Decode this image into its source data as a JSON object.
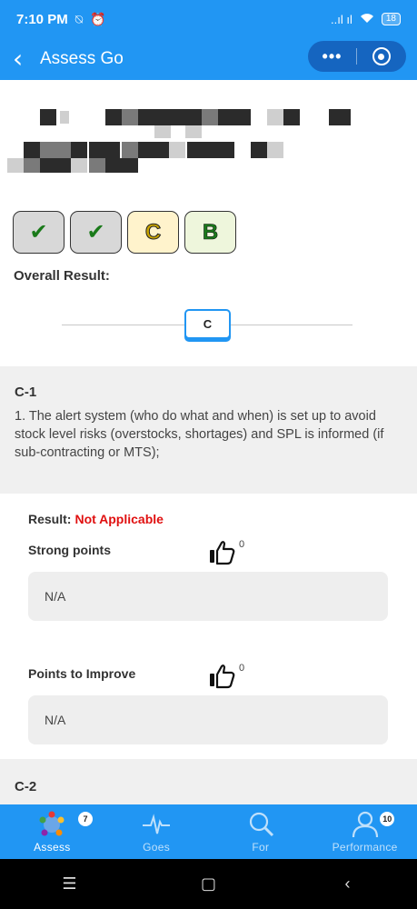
{
  "status_bar": {
    "time": "7:10 PM",
    "left_icons": "⍉ ⏰",
    "signal": "..ıl ıl",
    "battery": "18"
  },
  "header": {
    "title": "Assess Go",
    "more_label": "•••"
  },
  "badges": [
    {
      "symbol": "✔",
      "style": "check"
    },
    {
      "symbol": "✔",
      "style": "check"
    },
    {
      "symbol": "C",
      "style": "c"
    },
    {
      "symbol": "B",
      "style": "b"
    }
  ],
  "overall": {
    "label": "Overall Result:",
    "value": "C"
  },
  "question": {
    "id": "C-1",
    "text": "1. The alert system (who do what and when) is set up to avoid stock level risks (overstocks, shortages) and SPL is informed (if sub-contracting or MTS);"
  },
  "result": {
    "label": "Result:",
    "value": "Not Applicable"
  },
  "strong_points": {
    "title": "Strong points",
    "likes": "0",
    "note": "N/A"
  },
  "improve_points": {
    "title": "Points to Improve",
    "likes": "0",
    "note": "N/A"
  },
  "next_question": {
    "id": "C-2"
  },
  "tabs": [
    {
      "label": "Assess",
      "badge": "7",
      "icon": "assess-icon"
    },
    {
      "label": "Goes",
      "badge": "",
      "icon": "pulse-icon"
    },
    {
      "label": "For",
      "badge": "",
      "icon": "search-icon"
    },
    {
      "label": "Performance",
      "badge": "10",
      "icon": "person-icon"
    }
  ],
  "nav": {
    "menu": "☰",
    "home": "▢",
    "back": "‹"
  },
  "colors": {
    "primary": "#2196F3",
    "alert": "#e01010",
    "section_bg": "#f0f0f0"
  }
}
